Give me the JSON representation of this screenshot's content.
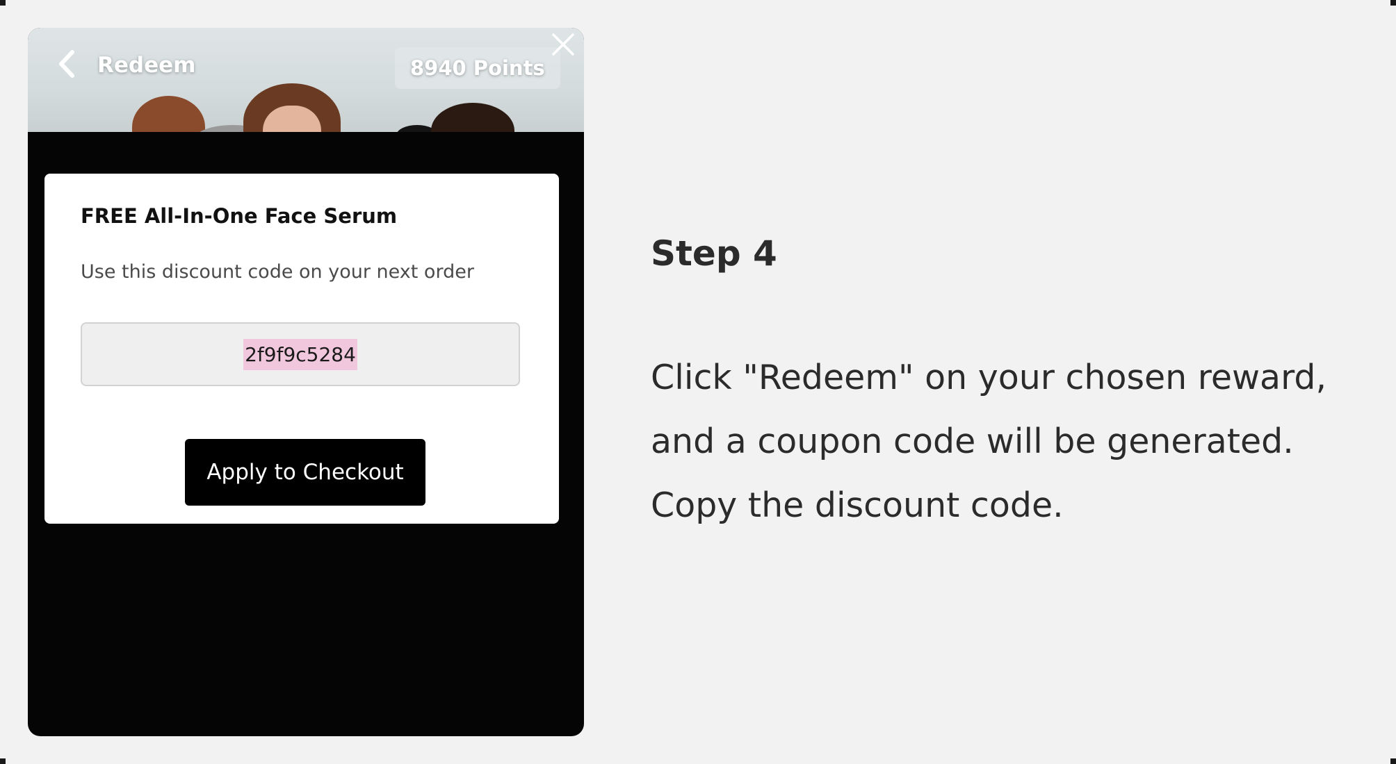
{
  "widget": {
    "header": {
      "back_icon": "chevron-left-icon",
      "title": "Redeem",
      "points": "8940 Points",
      "close_icon": "close-icon"
    },
    "card": {
      "reward_title": "FREE All-In-One Face Serum",
      "description": "Use this discount code on your next order",
      "discount_code": "2f9f9c5284",
      "apply_button_label": "Apply to Checkout"
    },
    "colors": {
      "panel_background": "#050505",
      "card_background": "#ffffff",
      "code_highlight": "#f0c7dc",
      "button_background": "#000000"
    }
  },
  "instructions": {
    "step_title": "Step 4",
    "body_lines": [
      "Click \"Redeem\" on your chosen reward,",
      "and a coupon code will be generated.",
      "Copy the discount code."
    ]
  }
}
